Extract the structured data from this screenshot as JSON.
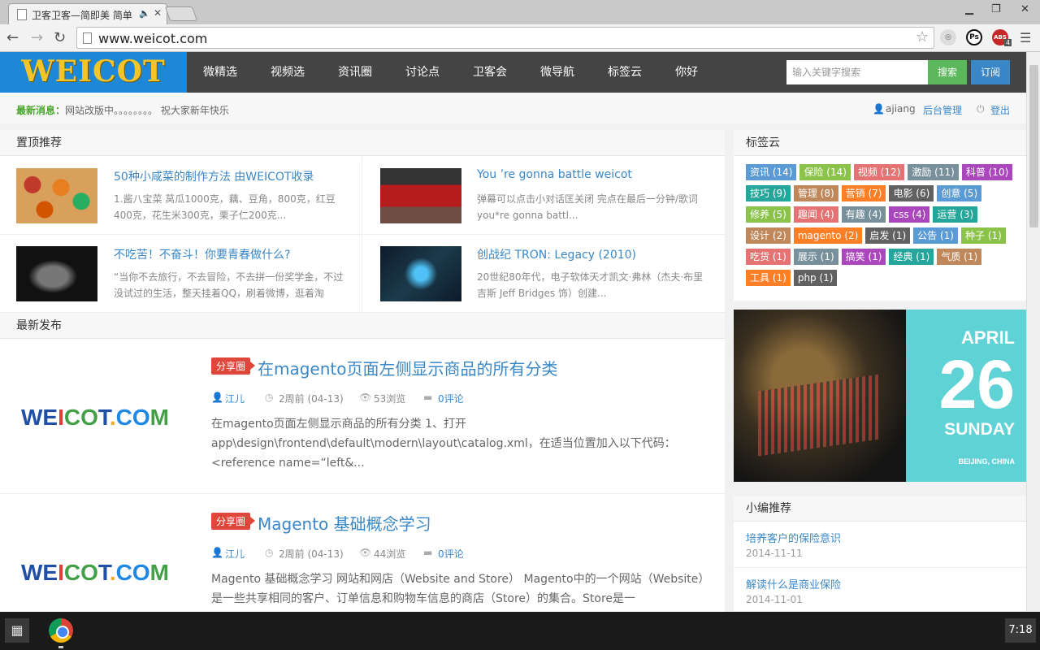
{
  "browser": {
    "tab_title": "卫客卫客—简即美 简单",
    "url": "www.weicot.com",
    "ext_ps": "Ps",
    "ext_abs": "ABS",
    "ext_badge": "4"
  },
  "header": {
    "logo": "WEICOT",
    "nav": [
      "微精选",
      "视频选",
      "资讯圈",
      "讨论点",
      "卫客会",
      "微导航",
      "标签云",
      "你好"
    ],
    "search_placeholder": "输入关键字搜索",
    "search_btn": "搜索",
    "subscribe_btn": "订阅"
  },
  "newsbar": {
    "label": "最新消息：",
    "message": "网站改版中。。。。。。。。  祝大家新年快乐",
    "user": "ajiang",
    "admin": "后台管理",
    "logout": "登出"
  },
  "featured": {
    "title": "置顶推荐",
    "items": [
      {
        "title": "50种小咸菜的制作方法 由WEICOT收录",
        "desc": "1.酱八宝菜 莴瓜1000克，藕、豆角，800克，红豆400克，花生米300克，栗子仁200克..."
      },
      {
        "title": "You ’re gonna battle weicot",
        "desc": "弹幕可以点击小对话匡关闭 完点在最后一分钟/歌词 you*re gonna battl..."
      },
      {
        "title": "不吃苦！不奋斗！你要青春做什么?",
        "desc": "“当你不去旅行，不去冒险，不去拼一份奖学金，不过没试过的生活，整天挂着QQ，刷着微博，逛着淘"
      },
      {
        "title": "创战纪 TRON: Legacy (2010)",
        "desc": "20世纪80年代，电子软体天才凯文·弗林（杰夫·布里吉斯 Jeff Bridges 饰）创建..."
      }
    ]
  },
  "latest": {
    "title": "最新发布",
    "posts": [
      {
        "logo": "WEICOT.COM",
        "tag": "分享圈",
        "title": "在magento页面左侧显示商品的所有分类",
        "author": "江儿",
        "time": "2周前 (04-13)",
        "views": "53浏览",
        "comments": "0评论",
        "excerpt": "在magento页面左侧显示商品的所有分类 1、打开app\\design\\frontend\\default\\modern\\layout\\catalog.xml，在适当位置加入以下代码：<reference name=“left&..."
      },
      {
        "logo": "WEICOT.COM",
        "tag": "分享圈",
        "title": "Magento 基础概念学习",
        "author": "江儿",
        "time": "2周前 (04-13)",
        "views": "44浏览",
        "comments": "0评论",
        "excerpt": "Magento 基础概念学习 网站和网店（Website and Store）  Magento中的一个网站（Website）是一些共享相同的客户、订单信息和购物车信息的商店（Store）的集合。Store是一"
      }
    ]
  },
  "tagcloud": {
    "title": "标签云",
    "tags": [
      {
        "label": "资讯 (14)",
        "color": "#5b9bd5"
      },
      {
        "label": "保险 (14)",
        "color": "#8bc34a"
      },
      {
        "label": "视频 (12)",
        "color": "#e57373"
      },
      {
        "label": "激励 (11)",
        "color": "#78909c"
      },
      {
        "label": "科普 (10)",
        "color": "#ab47bc"
      },
      {
        "label": "技巧 (9)",
        "color": "#26a69a"
      },
      {
        "label": "管理 (8)",
        "color": "#c0875a"
      },
      {
        "label": "营销 (7)",
        "color": "#ff7f27"
      },
      {
        "label": "电影 (6)",
        "color": "#616161"
      },
      {
        "label": "创意 (5)",
        "color": "#5b9bd5"
      },
      {
        "label": "修养 (5)",
        "color": "#8bc34a"
      },
      {
        "label": "趣闻 (4)",
        "color": "#e57373"
      },
      {
        "label": "有趣 (4)",
        "color": "#78909c"
      },
      {
        "label": "css (4)",
        "color": "#ab47bc"
      },
      {
        "label": "运营 (3)",
        "color": "#26a69a"
      },
      {
        "label": "设计 (2)",
        "color": "#c0875a"
      },
      {
        "label": "magento (2)",
        "color": "#ff7f27"
      },
      {
        "label": "启发 (1)",
        "color": "#616161"
      },
      {
        "label": "公告 (1)",
        "color": "#5b9bd5"
      },
      {
        "label": "种子 (1)",
        "color": "#8bc34a"
      },
      {
        "label": "吃货 (1)",
        "color": "#e57373"
      },
      {
        "label": "展示 (1)",
        "color": "#78909c"
      },
      {
        "label": "搞笑 (1)",
        "color": "#ab47bc"
      },
      {
        "label": "经典 (1)",
        "color": "#26a69a"
      },
      {
        "label": "气质 (1)",
        "color": "#c0875a"
      },
      {
        "label": "工具 (1)",
        "color": "#ff7f27"
      },
      {
        "label": "php (1)",
        "color": "#616161"
      }
    ]
  },
  "datecard": {
    "month": "APRIL",
    "day": "26",
    "weekday": "SUNDAY",
    "city": "BEIJING, CHINA",
    "color": "#5fd2d6"
  },
  "editor_pick": {
    "title": "小编推荐",
    "items": [
      {
        "title": "培养客户的保险意识",
        "date": "2014-11-11"
      },
      {
        "title": "解读什么是商业保险",
        "date": "2014-11-01"
      }
    ]
  },
  "taskbar": {
    "clock": "7:18"
  }
}
